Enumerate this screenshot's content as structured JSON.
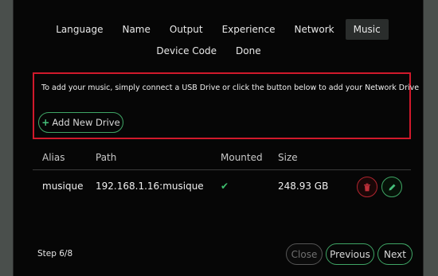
{
  "tabs_row1": [
    {
      "label": "Language"
    },
    {
      "label": "Name"
    },
    {
      "label": "Output"
    },
    {
      "label": "Experience"
    },
    {
      "label": "Network"
    },
    {
      "label": "Music",
      "active": true
    }
  ],
  "tabs_row2": [
    {
      "label": "Device Code"
    },
    {
      "label": "Done"
    }
  ],
  "info_text": "To add your music, simply connect a USB Drive or click the button below to add your Network Drive",
  "add_drive_label": "Add New Drive",
  "table": {
    "headers": {
      "alias": "Alias",
      "path": "Path",
      "mounted": "Mounted",
      "size": "Size"
    },
    "rows": [
      {
        "alias": "musique",
        "path": "192.168.1.16:musique",
        "mounted": "✔",
        "size": "248.93 GB"
      }
    ]
  },
  "footer": {
    "step": "Step 6/8",
    "close_label": "Close",
    "previous_label": "Previous",
    "next_label": "Next"
  },
  "colors": {
    "accent": "#3fa565",
    "danger": "#d0192b",
    "background": "#060606"
  },
  "icons": {
    "plus": "plus-icon",
    "check": "check-icon",
    "trash": "trash-icon",
    "pencil": "pencil-icon"
  }
}
